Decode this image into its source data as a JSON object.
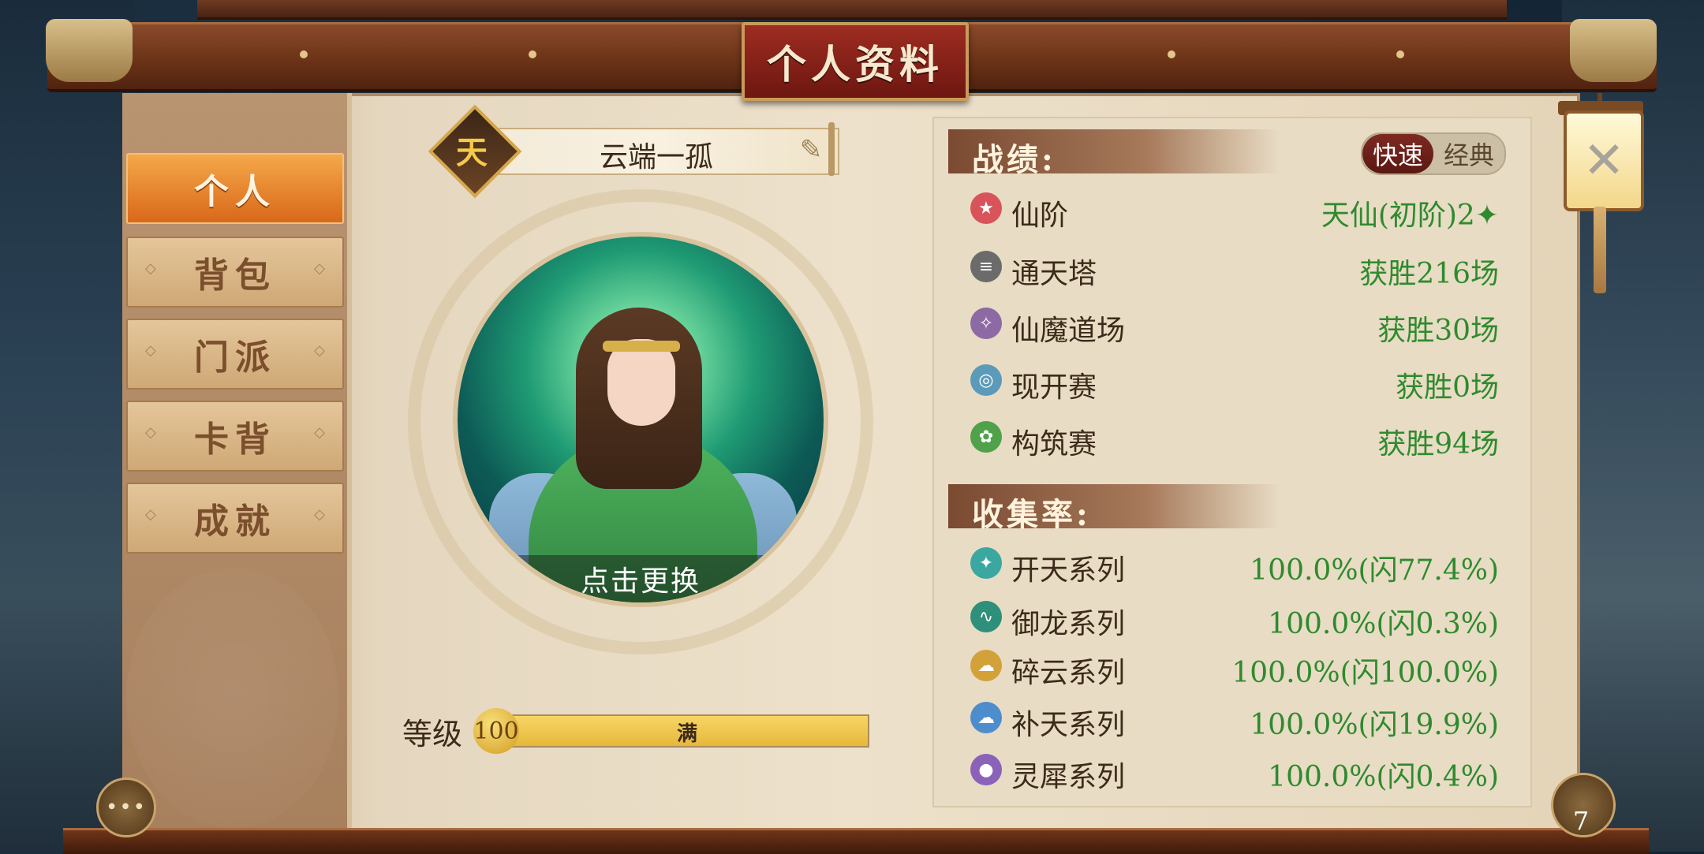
{
  "header": {
    "title": "个人资料"
  },
  "sidebar": {
    "tabs": [
      {
        "label": "个人",
        "active": true
      },
      {
        "label": "背包",
        "active": false
      },
      {
        "label": "门派",
        "active": false
      },
      {
        "label": "卡背",
        "active": false
      },
      {
        "label": "成就",
        "active": false
      }
    ]
  },
  "profile": {
    "rank_badge": "天",
    "name": "云端一孤",
    "avatar_caption": "点击更换",
    "level_label": "等级",
    "level": "100",
    "level_status": "满",
    "level_progress": 1.0
  },
  "record": {
    "title": "战绩:",
    "mode_toggle": {
      "selected": "快速",
      "other": "经典"
    },
    "rows": [
      {
        "icon": "star-icon",
        "label": "仙阶",
        "value": "天仙(初阶)2✦",
        "color": "#d9535b"
      },
      {
        "icon": "tower-icon",
        "label": "通天塔",
        "value": "获胜216场",
        "color": "#6b6b6b"
      },
      {
        "icon": "crane-icon",
        "label": "仙魔道场",
        "value": "获胜30场",
        "color": "#8e6aa5"
      },
      {
        "icon": "ring-icon",
        "label": "现开赛",
        "value": "获胜0场",
        "color": "#5b9ab9"
      },
      {
        "icon": "build-icon",
        "label": "构筑赛",
        "value": "获胜94场",
        "color": "#4fa24a"
      }
    ]
  },
  "collection": {
    "title": "收集率:",
    "rows": [
      {
        "icon": "kaitian-icon",
        "label": "开天系列",
        "value": "100.0%(闪77.4%)",
        "color": "#3aa8a0"
      },
      {
        "icon": "dragon-icon",
        "label": "御龙系列",
        "value": "100.0%(闪0.3%)",
        "color": "#2e8f7a"
      },
      {
        "icon": "cloud-icon",
        "label": "碎云系列",
        "value": "100.0%(闪100.0%)",
        "color": "#d2a13a"
      },
      {
        "icon": "sky-icon",
        "label": "补天系列",
        "value": "100.0%(闪19.9%)",
        "color": "#4e8dcc"
      },
      {
        "icon": "rhino-icon",
        "label": "灵犀系列",
        "value": "100.0%(闪0.4%)",
        "color": "#8a63b8"
      }
    ]
  },
  "corner": {
    "chat_label": "•••",
    "bag_count": "7"
  }
}
